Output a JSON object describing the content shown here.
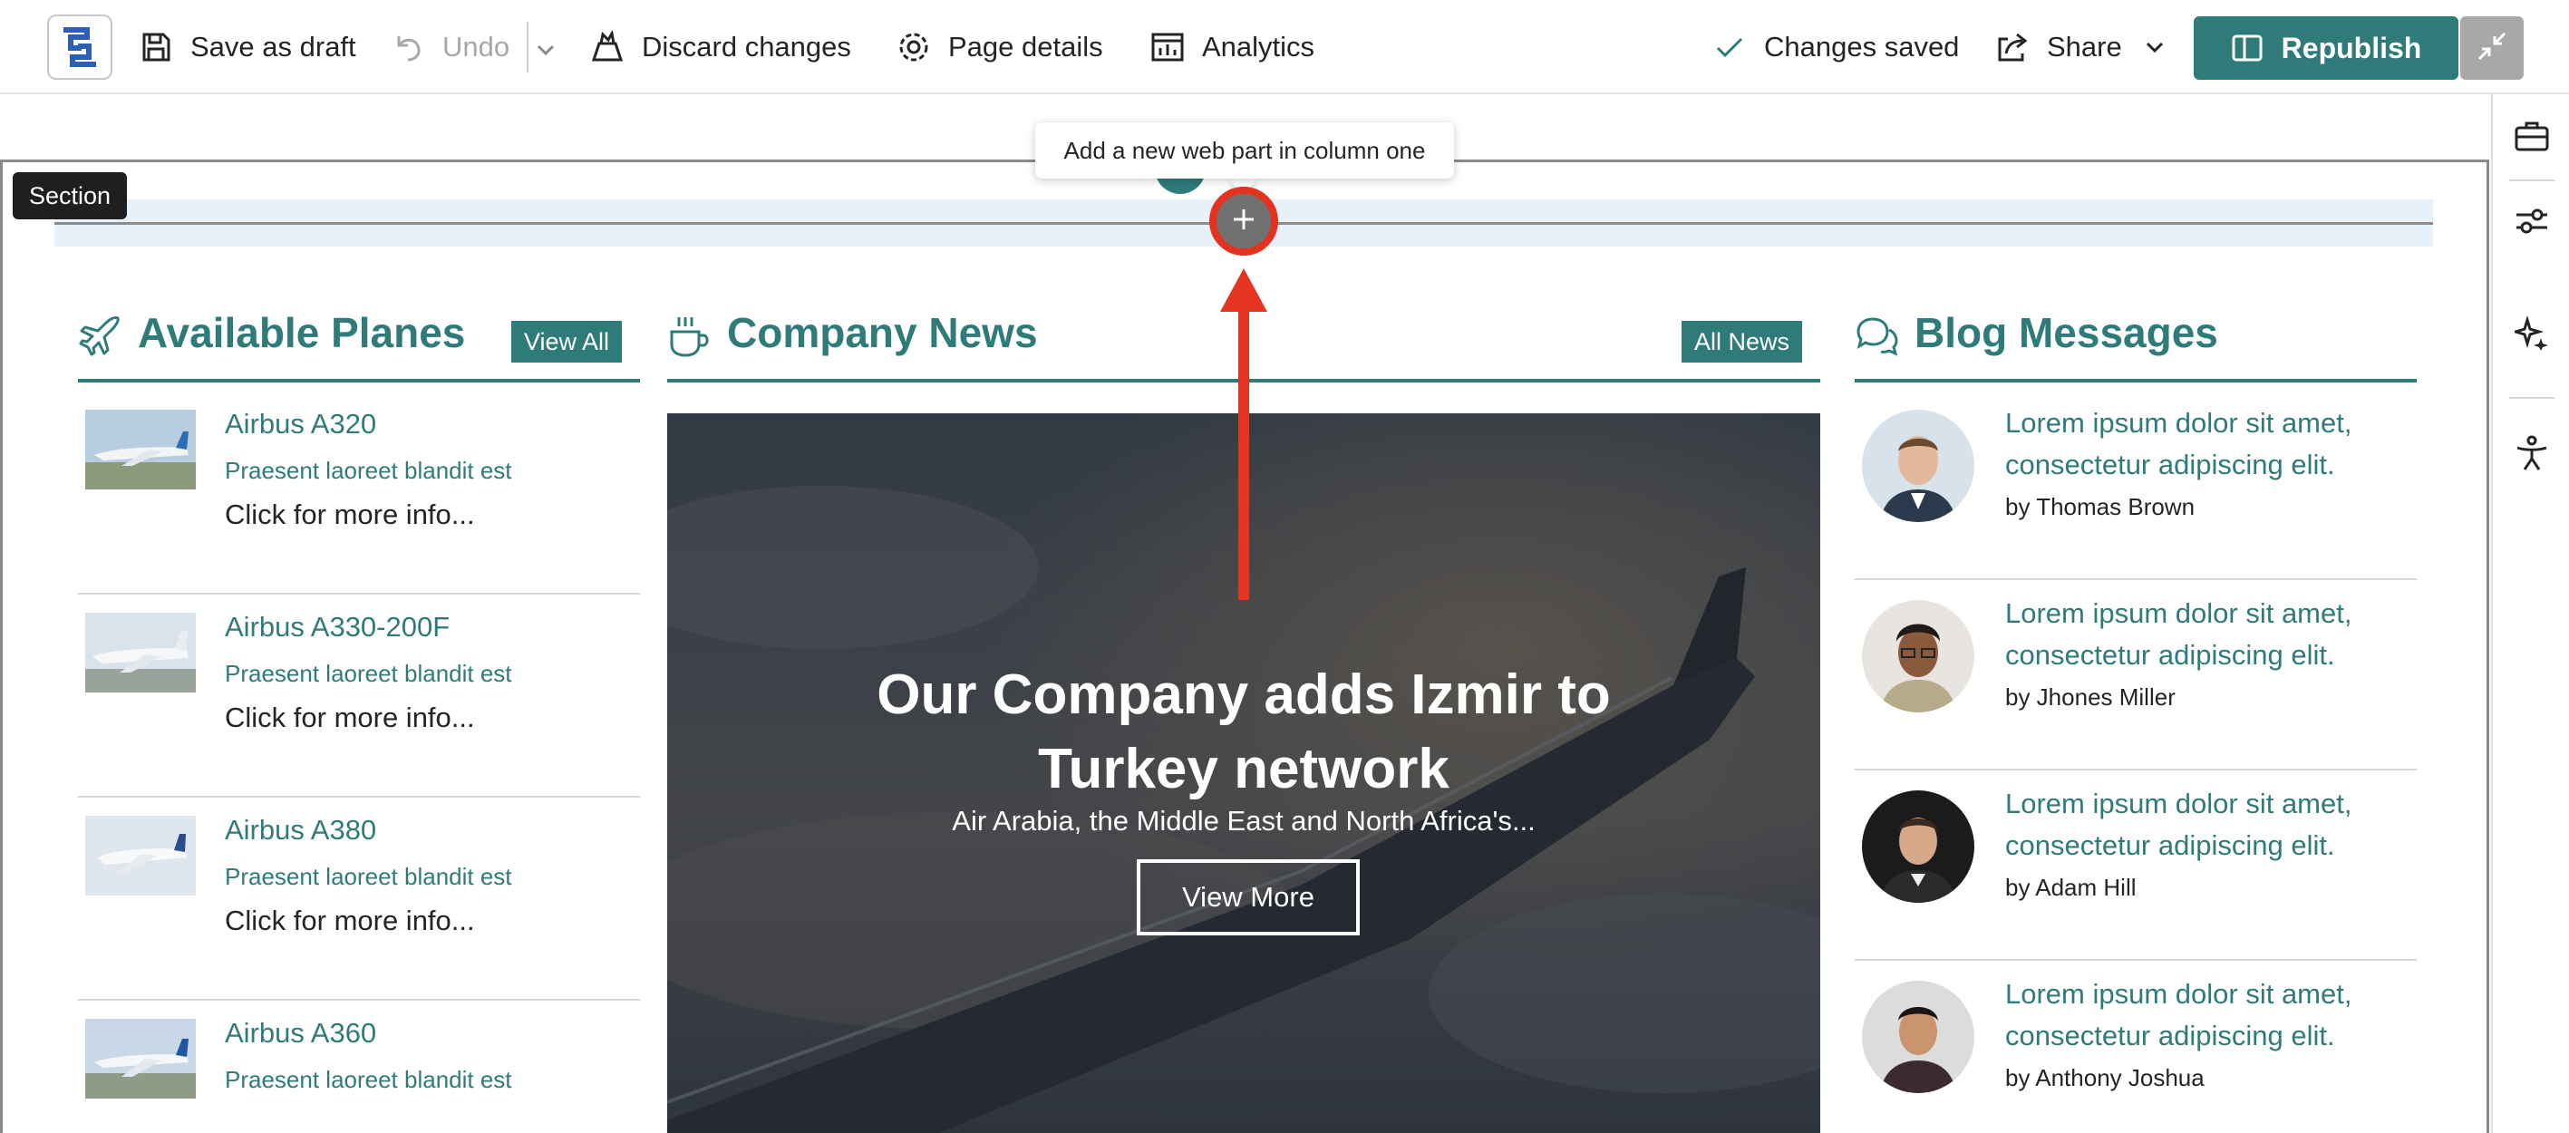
{
  "toolbar": {
    "save_draft": "Save as draft",
    "undo": "Undo",
    "discard": "Discard changes",
    "page_details": "Page details",
    "analytics": "Analytics",
    "status": "Changes saved",
    "share": "Share",
    "republish": "Republish"
  },
  "canvas": {
    "section_label": "Section",
    "add_tooltip": "Add a new web part in column one"
  },
  "planes": {
    "title": "Available Planes",
    "view_all": "View All",
    "items": [
      {
        "title": "Airbus A320",
        "subtitle": "Praesent laoreet blandit est",
        "more": "Click for more info..."
      },
      {
        "title": "Airbus A330-200F",
        "subtitle": "Praesent laoreet blandit est",
        "more": "Click for more info..."
      },
      {
        "title": "Airbus A380",
        "subtitle": "Praesent laoreet blandit est",
        "more": "Click for more info..."
      },
      {
        "title": "Airbus A360",
        "subtitle": "Praesent laoreet blandit est",
        "more": ""
      }
    ]
  },
  "news": {
    "title": "Company News",
    "all_news": "All News",
    "headline_line1": "Our Company adds Izmir to",
    "headline_line2": "Turkey network",
    "dek": "Air Arabia, the Middle East and North Africa's...",
    "cta": "View More"
  },
  "blog": {
    "title": "Blog Messages",
    "items": [
      {
        "text": "Lorem ipsum dolor sit amet, consectetur adipiscing elit.",
        "author": "by Thomas Brown"
      },
      {
        "text": "Lorem ipsum dolor sit amet, consectetur adipiscing elit.",
        "author": "by Jhones Miller"
      },
      {
        "text": "Lorem ipsum dolor sit amet, consectetur adipiscing elit.",
        "author": "by Adam Hill"
      },
      {
        "text": "Lorem ipsum dolor sit amet, consectetur adipiscing elit.",
        "author": "by Anthony Joshua"
      }
    ]
  },
  "icons": {
    "logo": "app-logo-icon",
    "save": "save-icon",
    "undo": "undo-icon",
    "discard": "discard-icon",
    "page_details": "gear-icon",
    "analytics": "analytics-icon",
    "status": "checkmark-icon",
    "share": "share-icon",
    "republish": "book-open-icon",
    "collapse": "collapse-icon",
    "rail": [
      "toolbox-icon",
      "sliders-icon",
      "sparkle-icon",
      "accessibility-icon"
    ]
  },
  "colors": {
    "accent": "#2f7b7a",
    "annotation": "#e53422"
  }
}
